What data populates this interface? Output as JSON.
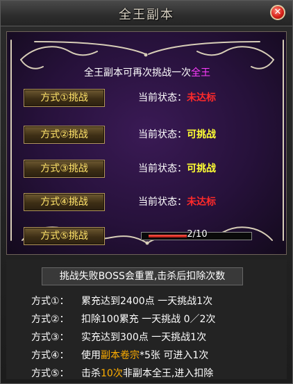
{
  "window": {
    "title": "全王副本",
    "close_icon": "close-icon"
  },
  "panel": {
    "headline_prefix": "全王副本可再次挑战一次",
    "headline_highlight": "全王",
    "options": [
      {
        "label": "方式①挑战",
        "status_label": "当前状态：",
        "status_value": "未达标",
        "status_color": "#ff2a2a"
      },
      {
        "label": "方式②挑战",
        "status_label": "当前状态：",
        "status_value": "可挑战",
        "status_color": "#ffff33"
      },
      {
        "label": "方式③挑战",
        "status_label": "当前状态：",
        "status_value": "可挑战",
        "status_color": "#ffff33"
      },
      {
        "label": "方式④挑战",
        "status_label": "当前状态：",
        "status_value": "未达标",
        "status_color": "#ff2a2a"
      },
      {
        "label": "方式⑤挑战"
      }
    ],
    "progress": {
      "text": "2/10",
      "current": 2,
      "max": 10
    }
  },
  "info": {
    "notice": "挑战失败BOSS会重置,击杀后扣除次数",
    "rules": [
      {
        "label": "方式①：",
        "text": "累充达到2400点 一天挑战1次"
      },
      {
        "label": "方式②：",
        "text": "扣除100累充 一天挑战 0／2次"
      },
      {
        "label": "方式③：",
        "text": "实充达到300点 一天挑战1次"
      },
      {
        "label": "方式④：",
        "pre": "使用",
        "accent": "副本卷宗",
        "post": "*5张 可进入1次"
      },
      {
        "label": "方式⑤：",
        "pre": "击杀",
        "accent": "10次",
        "post": "非副本全王,进入扣除"
      }
    ]
  },
  "colors": {
    "accent_orange": "#ffae00",
    "highlight_magenta": "#ff3cff",
    "button_text": "#ffe36a"
  }
}
